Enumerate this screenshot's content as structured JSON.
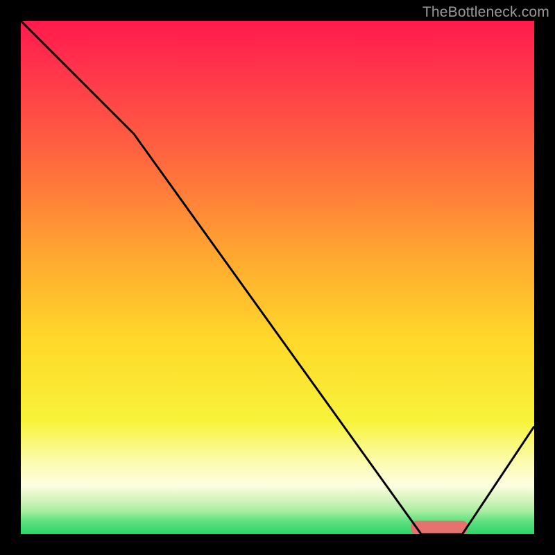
{
  "watermark": "TheBottleneck.com",
  "colors": {
    "frame": "#000000",
    "line": "#000000",
    "bar": "#e6716f",
    "gradient_stops": [
      {
        "offset": 0.0,
        "color": "#ff1a4d"
      },
      {
        "offset": 0.12,
        "color": "#ff3b4a"
      },
      {
        "offset": 0.28,
        "color": "#ff6b3e"
      },
      {
        "offset": 0.45,
        "color": "#ffa531"
      },
      {
        "offset": 0.62,
        "color": "#ffd82a"
      },
      {
        "offset": 0.78,
        "color": "#f8f33a"
      },
      {
        "offset": 0.86,
        "color": "#fcfcb0"
      },
      {
        "offset": 0.905,
        "color": "#fdfde0"
      },
      {
        "offset": 0.93,
        "color": "#d9f5c0"
      },
      {
        "offset": 0.955,
        "color": "#a8eea0"
      },
      {
        "offset": 0.975,
        "color": "#5fe07f"
      },
      {
        "offset": 1.0,
        "color": "#2bd46a"
      }
    ]
  },
  "chart_data": {
    "type": "line",
    "title": "",
    "xlabel": "",
    "ylabel": "",
    "xlim": [
      0,
      100
    ],
    "ylim": [
      0,
      100
    ],
    "x": [
      0,
      22,
      78,
      86,
      100
    ],
    "values": [
      100,
      78,
      0,
      0,
      21
    ],
    "annotations": [
      {
        "kind": "hbar",
        "x_start": 76,
        "x_end": 87,
        "y": 1.3,
        "thickness": 2.6
      }
    ]
  }
}
